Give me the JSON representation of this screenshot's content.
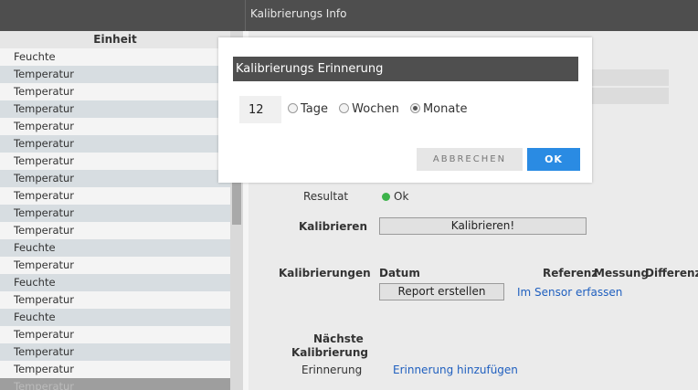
{
  "topbar": {
    "title": "Kalibrierungs Info"
  },
  "list": {
    "header": "Einheit",
    "items": [
      "Feuchte",
      "Temperatur",
      "Temperatur",
      "Temperatur",
      "Temperatur",
      "Temperatur",
      "Temperatur",
      "Temperatur",
      "Temperatur",
      "Temperatur",
      "Temperatur",
      "Feuchte",
      "Temperatur",
      "Feuchte",
      "Temperatur",
      "Feuchte",
      "Temperatur",
      "Temperatur",
      "Temperatur",
      "Temperatur"
    ]
  },
  "panel": {
    "resultat_label": "Resultat",
    "resultat_value": "Ok",
    "kalibrieren_label": "Kalibrieren",
    "kalibrieren_button": "Kalibrieren!",
    "kalibrierungen_label": "Kalibrierungen",
    "columns": [
      "Datum",
      "Referenz",
      "Messung",
      "Differenz"
    ],
    "report_button": "Report erstellen",
    "sensor_link": "Im Sensor erfassen",
    "naechste_line1": "Nächste",
    "naechste_line2": "Kalibrierung",
    "erinnerung_label": "Erinnerung",
    "erinnerung_link": "Erinnerung hinzufügen"
  },
  "modal": {
    "title": "Kalibrierungs Erinnerung",
    "quantity": "12",
    "options": [
      "Tage",
      "Wochen",
      "Monate"
    ],
    "selected": "Monate",
    "cancel": "ABBRECHEN",
    "ok": "OK"
  },
  "colors": {
    "accent": "#2a8be3",
    "status_ok": "#3cb34a",
    "header_bg": "#4e4e4e"
  }
}
